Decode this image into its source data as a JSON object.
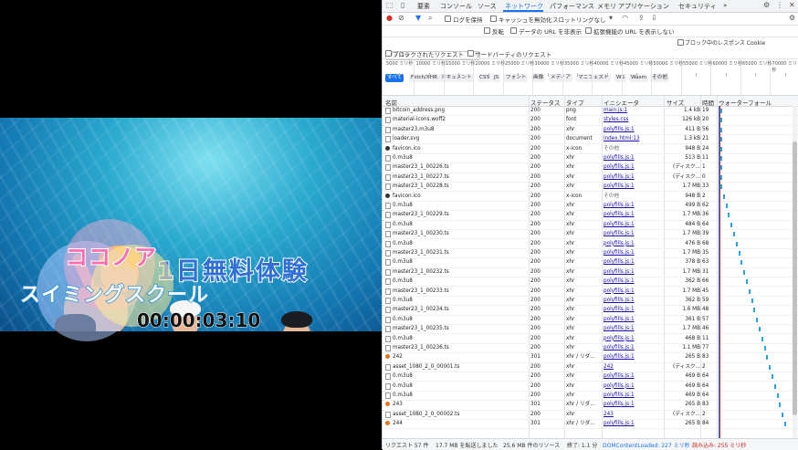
{
  "video": {
    "title": "1日無料体験",
    "school_line1": "ココノア",
    "school_line2": "スイミングスクール",
    "timecode": "00:00:03:10"
  },
  "devtools": {
    "tabs": [
      "要素",
      "コンソール",
      "ソース",
      "ネットワーク",
      "パフォーマンス",
      "メモリ",
      "アプリケーション",
      "セキュリティ",
      "»"
    ],
    "active_tab": "ネットワーク",
    "toolbar": {
      "preserve_log": "ログを保持",
      "disable_cache": "キャッシュを無効化",
      "throttle": "スロットリングなし"
    },
    "filter": {
      "placeholder": "フィルタ",
      "invert": "反転",
      "hide_data_urls": "データの URL を非表示",
      "hide_ext_urls": "拡張機能の URL を表示しない"
    },
    "type_chips": [
      "すべて",
      "Fetch/XHR",
      "ドキュメント",
      "CSS",
      "JS",
      "フォント",
      "画像",
      "メディア",
      "マニフェスト",
      "WS",
      "Wasm",
      "その他"
    ],
    "blocked_cookies": "ブロック中のレスポンス Cookie",
    "blocked_requests": "ブロックされたリクエスト",
    "third_party": "サードパーティのリクエスト",
    "timeline_ticks": [
      "5000 ミリ秒",
      "10000 ミリ秒",
      "15000 ミリ秒",
      "20000 ミリ秒",
      "25000 ミリ秒",
      "30000 ミリ秒",
      "35000 ミリ秒",
      "40000 ミリ秒",
      "45000 ミリ秒",
      "50000 ミリ秒",
      "55000 ミリ秒",
      "60000 ミリ秒",
      "65000 ミリ秒",
      "70000 ミリ秒"
    ],
    "columns": {
      "name": "名前",
      "status": "ステータス",
      "type": "タイプ",
      "initiator": "イニシエータ",
      "size": "サイズ",
      "time": "時間",
      "waterfall": "ウォーターフォール"
    },
    "rows": [
      {
        "name": "bitcoin_address.png",
        "status": "200",
        "type": "png",
        "initiator": "main.js:1",
        "size": "1.4 kB",
        "time": "19",
        "icon": "file"
      },
      {
        "name": "material-icons.woff2",
        "status": "200",
        "type": "font",
        "initiator": "styles.css",
        "size": "126 kB",
        "time": "20",
        "icon": "file"
      },
      {
        "name": "master23.m3u8",
        "status": "200",
        "type": "xhr",
        "initiator": "polyfills.js:1",
        "size": "411 B",
        "time": "56",
        "icon": "file"
      },
      {
        "name": "loader.svg",
        "status": "200",
        "type": "document",
        "initiator": "index.html:13",
        "size": "1.3 kB",
        "time": "21",
        "icon": "file"
      },
      {
        "name": "favicon.ico",
        "status": "200",
        "type": "x-icon",
        "initiator": "その他",
        "size": "948 B",
        "time": "24",
        "icon": "fav"
      },
      {
        "name": "0.m3u8",
        "status": "200",
        "type": "xhr",
        "initiator": "polyfills.js:1",
        "size": "513 B",
        "time": "11",
        "icon": "file"
      },
      {
        "name": "master23_1_00226.ts",
        "status": "200",
        "type": "xhr",
        "initiator": "polyfills.js:1",
        "size": "(ディスク...",
        "time": "1",
        "icon": "file"
      },
      {
        "name": "master23_1_00227.ts",
        "status": "200",
        "type": "xhr",
        "initiator": "polyfills.js:1",
        "size": "(ディスク...",
        "time": "0",
        "icon": "file"
      },
      {
        "name": "master23_1_00228.ts",
        "status": "200",
        "type": "xhr",
        "initiator": "polyfills.js:1",
        "size": "1.7 MB",
        "time": "33",
        "icon": "file"
      },
      {
        "name": "favicon.ico",
        "status": "200",
        "type": "x-icon",
        "initiator": "その他",
        "size": "948 B",
        "time": "2",
        "icon": "fav"
      },
      {
        "name": "0.m3u8",
        "status": "200",
        "type": "xhr",
        "initiator": "polyfills.js:1",
        "size": "499 B",
        "time": "62",
        "icon": "file"
      },
      {
        "name": "master23_1_00229.ts",
        "status": "200",
        "type": "xhr",
        "initiator": "polyfills.js:1",
        "size": "1.7 MB",
        "time": "36",
        "icon": "file"
      },
      {
        "name": "0.m3u8",
        "status": "200",
        "type": "xhr",
        "initiator": "polyfills.js:1",
        "size": "484 B",
        "time": "64",
        "icon": "file"
      },
      {
        "name": "master23_1_00230.ts",
        "status": "200",
        "type": "xhr",
        "initiator": "polyfills.js:1",
        "size": "1.7 MB",
        "time": "39",
        "icon": "file"
      },
      {
        "name": "0.m3u8",
        "status": "200",
        "type": "xhr",
        "initiator": "polyfills.js:1",
        "size": "476 B",
        "time": "68",
        "icon": "file"
      },
      {
        "name": "master23_1_00231.ts",
        "status": "200",
        "type": "xhr",
        "initiator": "polyfills.js:1",
        "size": "1.7 MB",
        "time": "35",
        "icon": "file"
      },
      {
        "name": "0.m3u8",
        "status": "200",
        "type": "xhr",
        "initiator": "polyfills.js:1",
        "size": "378 B",
        "time": "63",
        "icon": "file"
      },
      {
        "name": "master23_1_00232.ts",
        "status": "200",
        "type": "xhr",
        "initiator": "polyfills.js:1",
        "size": "1.7 MB",
        "time": "31",
        "icon": "file"
      },
      {
        "name": "0.m3u8",
        "status": "200",
        "type": "xhr",
        "initiator": "polyfills.js:1",
        "size": "362 B",
        "time": "66",
        "icon": "file"
      },
      {
        "name": "master23_1_00233.ts",
        "status": "200",
        "type": "xhr",
        "initiator": "polyfills.js:1",
        "size": "1.7 MB",
        "time": "45",
        "icon": "file"
      },
      {
        "name": "0.m3u8",
        "status": "200",
        "type": "xhr",
        "initiator": "polyfills.js:1",
        "size": "362 B",
        "time": "59",
        "icon": "file"
      },
      {
        "name": "master23_1_00234.ts",
        "status": "200",
        "type": "xhr",
        "initiator": "polyfills.js:1",
        "size": "1.6 MB",
        "time": "48",
        "icon": "file"
      },
      {
        "name": "0.m3u8",
        "status": "200",
        "type": "xhr",
        "initiator": "polyfills.js:1",
        "size": "361 B",
        "time": "57",
        "icon": "file"
      },
      {
        "name": "master23_1_00235.ts",
        "status": "200",
        "type": "xhr",
        "initiator": "polyfills.js:1",
        "size": "1.7 MB",
        "time": "46",
        "icon": "file"
      },
      {
        "name": "0.m3u8",
        "status": "200",
        "type": "xhr",
        "initiator": "polyfills.js:1",
        "size": "468 B",
        "time": "11",
        "icon": "file"
      },
      {
        "name": "master23_1_00236.ts",
        "status": "200",
        "type": "xhr",
        "initiator": "polyfills.js:1",
        "size": "1.1 MB",
        "time": "77",
        "icon": "file"
      },
      {
        "name": "242",
        "status": "301",
        "type": "xhr / リダ...",
        "initiator": "polyfills.js:1",
        "size": "265 B",
        "time": "83",
        "icon": "err"
      },
      {
        "name": "asset_1080_2_0_00001.ts",
        "status": "200",
        "type": "xhr",
        "initiator": "242",
        "size": "(ディスク...",
        "time": "2",
        "icon": "file"
      },
      {
        "name": "0.m3u8",
        "status": "200",
        "type": "xhr",
        "initiator": "polyfills.js:1",
        "size": "469 B",
        "time": "64",
        "icon": "file"
      },
      {
        "name": "0.m3u8",
        "status": "200",
        "type": "xhr",
        "initiator": "polyfills.js:1",
        "size": "469 B",
        "time": "64",
        "icon": "file"
      },
      {
        "name": "0.m3u8",
        "status": "200",
        "type": "xhr",
        "initiator": "polyfills.js:1",
        "size": "469 B",
        "time": "64",
        "icon": "file"
      },
      {
        "name": "243",
        "status": "301",
        "type": "xhr / リダ...",
        "initiator": "polyfills.js:1",
        "size": "265 B",
        "time": "83",
        "icon": "err"
      },
      {
        "name": "asset_1080_2_0_00002.ts",
        "status": "200",
        "type": "xhr",
        "initiator": "243",
        "size": "(ディスク...",
        "time": "2",
        "icon": "file"
      },
      {
        "name": "244",
        "status": "301",
        "type": "xhr / リダ...",
        "initiator": "polyfills.js:1",
        "size": "265 B",
        "time": "84",
        "icon": "err"
      }
    ],
    "status_bar": {
      "requests": "リクエスト 57 件",
      "transferred": "17.7 MB を転送しました",
      "resources": "25.6 MB 件のリソース",
      "finish": "終了: 1.1 分",
      "dcl": "DOMContentLoaded: 227 ミリ秒",
      "load": "読み込み: 255 ミリ秒"
    }
  }
}
